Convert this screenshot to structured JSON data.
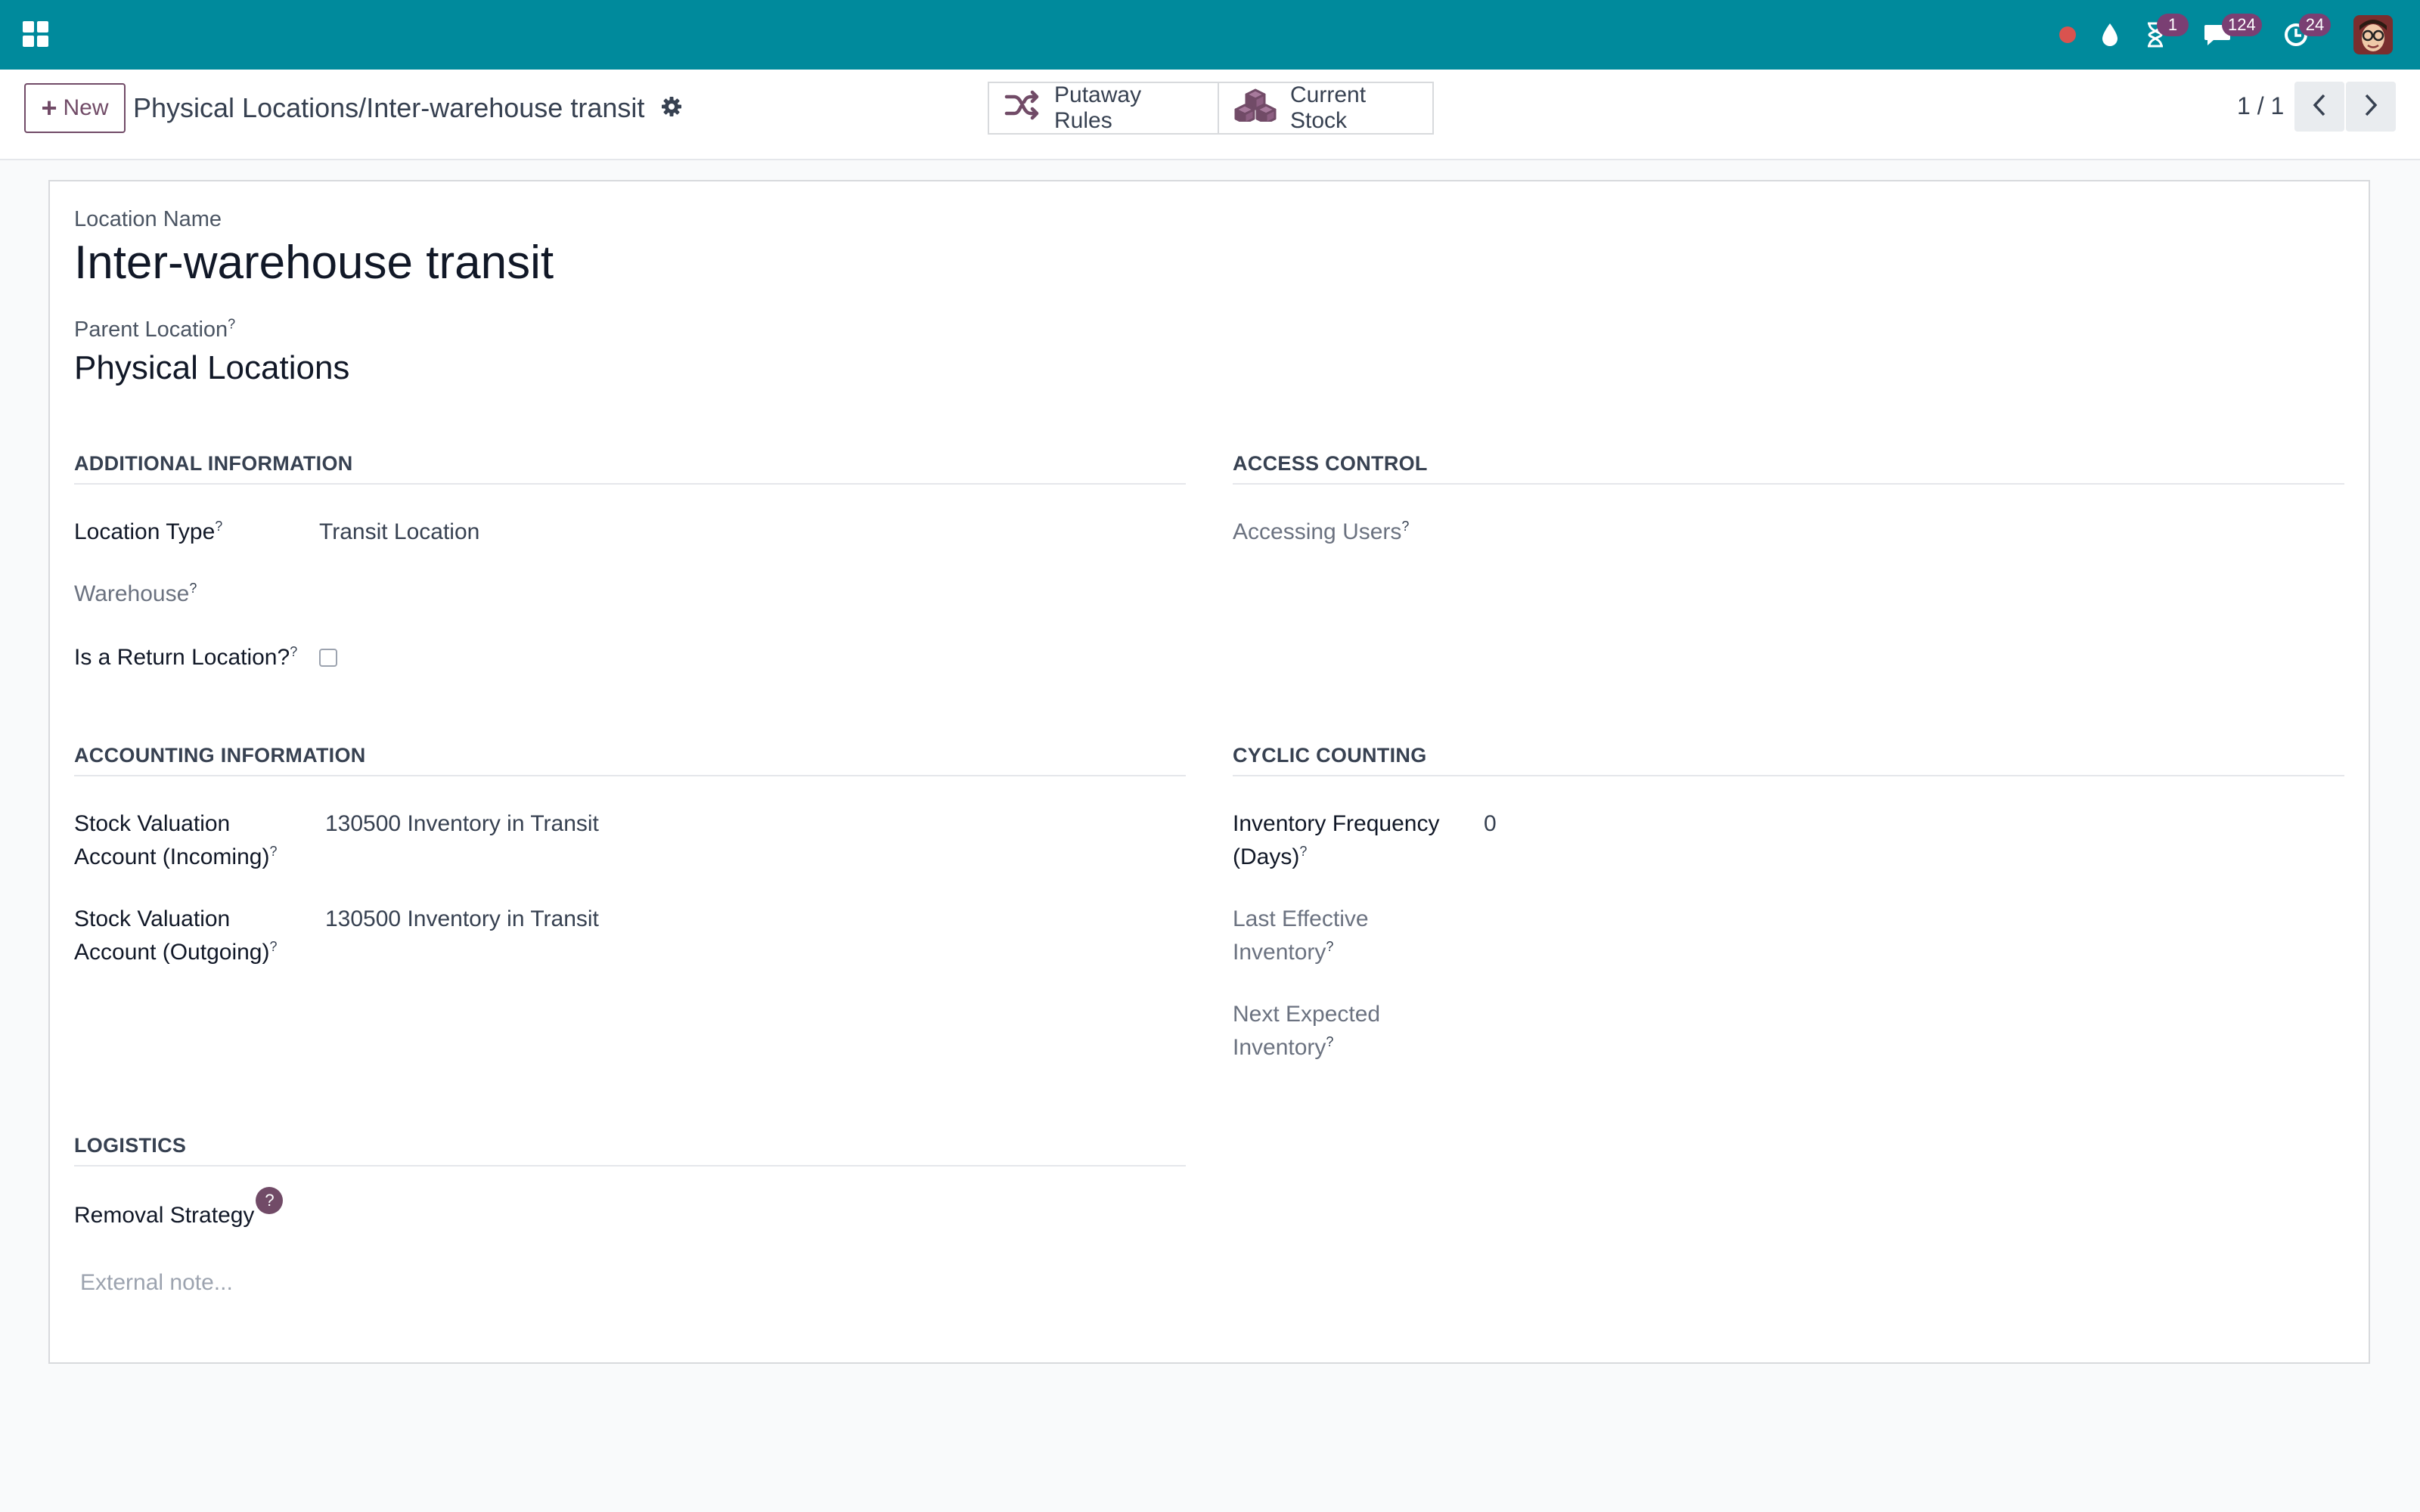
{
  "navbar": {
    "icons": [
      "apps-icon",
      "record-dot-icon",
      "droplet-icon",
      "hourglass-icon",
      "chat-icon",
      "clock-icon"
    ],
    "hourglass_badge": "1",
    "chat_badge": "124",
    "clock_badge": "24",
    "colors": {
      "bar": "#008a9c",
      "badge": "#7a3f73",
      "record_dot": "#d9534f"
    }
  },
  "control_panel": {
    "new_label": "New",
    "breadcrumb_parent": "Physical Locations",
    "breadcrumb_separator": "/",
    "breadcrumb_current": "Inter-warehouse transit",
    "putaway_label": "Putaway Rules",
    "stock_label": "Current Stock",
    "pager": "1 / 1"
  },
  "form": {
    "location_name_label": "Location Name",
    "location_name": "Inter-warehouse transit",
    "parent_location_label": "Parent Location",
    "parent_location": "Physical Locations",
    "help_mark": "?",
    "additional": {
      "heading": "ADDITIONAL INFORMATION",
      "location_type_label": "Location Type",
      "location_type": "Transit Location",
      "warehouse_label": "Warehouse",
      "return_label": "Is a Return Location?",
      "return_checked": false
    },
    "access": {
      "heading": "ACCESS CONTROL",
      "users_label": "Accessing Users"
    },
    "accounting": {
      "heading": "ACCOUNTING INFORMATION",
      "incoming_label_1": "Stock Valuation",
      "incoming_label_2": "Account (Incoming)",
      "incoming_value": "130500 Inventory in Transit",
      "outgoing_label_1": "Stock Valuation",
      "outgoing_label_2": "Account (Outgoing)",
      "outgoing_value": "130500 Inventory in Transit"
    },
    "cyclic": {
      "heading": "CYCLIC COUNTING",
      "frequency_label_1": "Inventory Frequency",
      "frequency_label_2": "(Days)",
      "frequency_value": "0",
      "last_label_1": "Last Effective",
      "last_label_2": "Inventory",
      "next_label_1": "Next Expected",
      "next_label_2": "Inventory"
    },
    "logistics": {
      "heading": "LOGISTICS",
      "removal_label": "Removal Strategy"
    },
    "note_placeholder": "External note..."
  }
}
